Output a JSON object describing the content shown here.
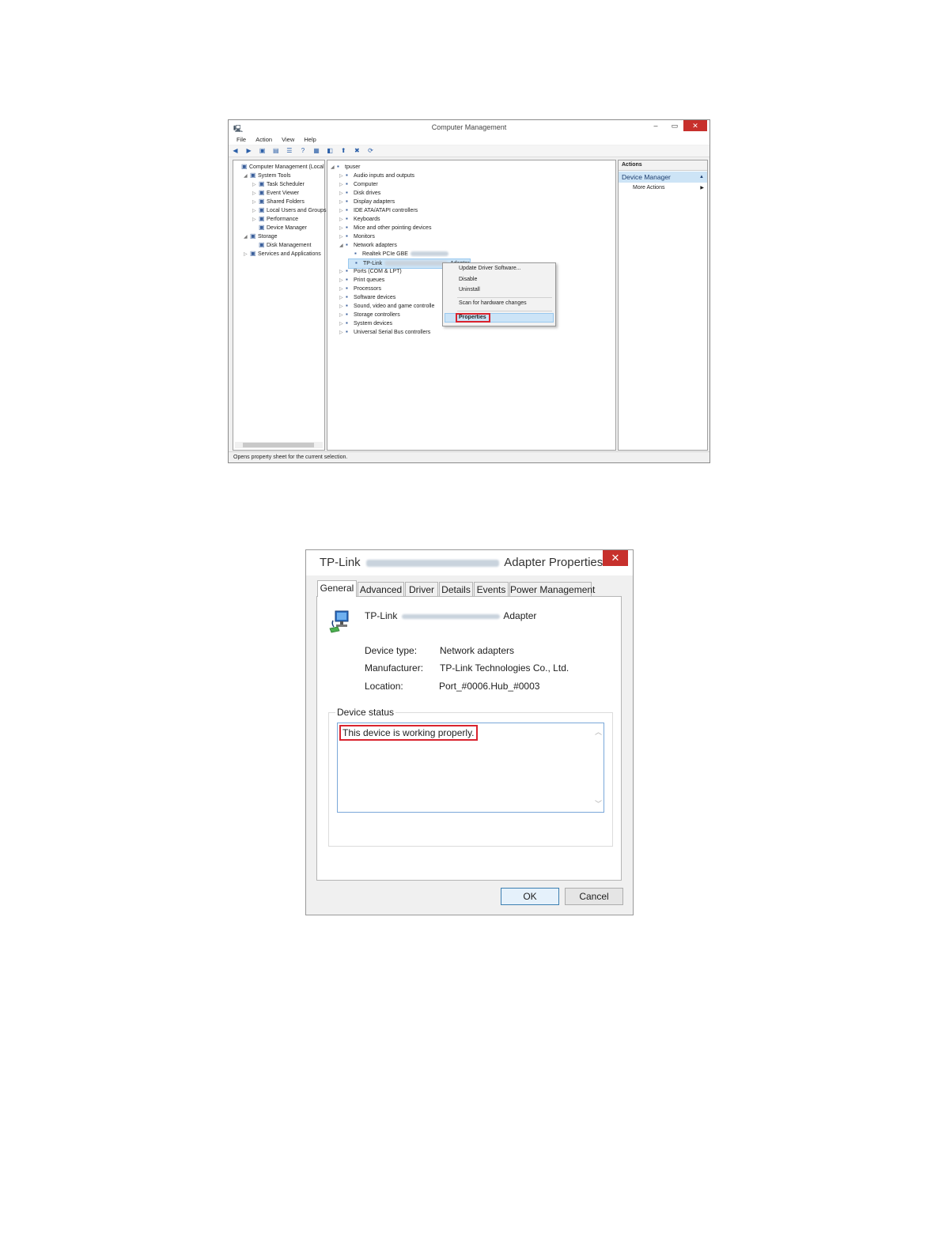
{
  "cm": {
    "title": "Computer Management",
    "menu": [
      "File",
      "Action",
      "View",
      "Help"
    ],
    "tree": [
      {
        "label": "Computer Management (Local",
        "level": 0,
        "twisty": ""
      },
      {
        "label": "System Tools",
        "level": 1,
        "twisty": "◢"
      },
      {
        "label": "Task Scheduler",
        "level": 2,
        "twisty": "▷"
      },
      {
        "label": "Event Viewer",
        "level": 2,
        "twisty": "▷"
      },
      {
        "label": "Shared Folders",
        "level": 2,
        "twisty": "▷"
      },
      {
        "label": "Local Users and Groups",
        "level": 2,
        "twisty": "▷"
      },
      {
        "label": "Performance",
        "level": 2,
        "twisty": "▷"
      },
      {
        "label": "Device Manager",
        "level": 2,
        "twisty": ""
      },
      {
        "label": "Storage",
        "level": 1,
        "twisty": "◢"
      },
      {
        "label": "Disk Management",
        "level": 2,
        "twisty": ""
      },
      {
        "label": "Services and Applications",
        "level": 1,
        "twisty": "▷"
      }
    ],
    "devices": [
      {
        "label": "tpuser",
        "level": 0,
        "twisty": "◢"
      },
      {
        "label": "Audio inputs and outputs",
        "level": 1,
        "twisty": "▷"
      },
      {
        "label": "Computer",
        "level": 1,
        "twisty": "▷"
      },
      {
        "label": "Disk drives",
        "level": 1,
        "twisty": "▷"
      },
      {
        "label": "Display adapters",
        "level": 1,
        "twisty": "▷"
      },
      {
        "label": "IDE ATA/ATAPI controllers",
        "level": 1,
        "twisty": "▷"
      },
      {
        "label": "Keyboards",
        "level": 1,
        "twisty": "▷"
      },
      {
        "label": "Mice and other pointing devices",
        "level": 1,
        "twisty": "▷"
      },
      {
        "label": "Monitors",
        "level": 1,
        "twisty": "▷"
      },
      {
        "label": "Network adapters",
        "level": 1,
        "twisty": "◢"
      },
      {
        "label": "Realtek PCIe GBE",
        "level": 2,
        "twisty": "",
        "blur": true
      },
      {
        "label": "TP-Link",
        "level": 2,
        "twisty": "",
        "blur": true,
        "suffix": "Adapter",
        "selected": true
      },
      {
        "label": "Ports (COM & LPT)",
        "level": 1,
        "twisty": "▷"
      },
      {
        "label": "Print queues",
        "level": 1,
        "twisty": "▷"
      },
      {
        "label": "Processors",
        "level": 1,
        "twisty": "▷"
      },
      {
        "label": "Software devices",
        "level": 1,
        "twisty": "▷"
      },
      {
        "label": "Sound, video and game controlle",
        "level": 1,
        "twisty": "▷"
      },
      {
        "label": "Storage controllers",
        "level": 1,
        "twisty": "▷"
      },
      {
        "label": "System devices",
        "level": 1,
        "twisty": "▷"
      },
      {
        "label": "Universal Serial Bus controllers",
        "level": 1,
        "twisty": "▷"
      }
    ],
    "context_menu": {
      "update": "Update Driver Software...",
      "disable": "Disable",
      "uninstall": "Uninstall",
      "scan": "Scan for hardware changes",
      "properties": "Properties"
    },
    "actions": {
      "header": "Actions",
      "device_manager": "Device Manager",
      "more": "More Actions"
    },
    "status": "Opens property sheet for the current selection."
  },
  "dlg": {
    "title_prefix": "TP-Link",
    "title_suffix": "Adapter Properties",
    "tabs": [
      "General",
      "Advanced",
      "Driver",
      "Details",
      "Events",
      "Power Management"
    ],
    "device_name_prefix": "TP-Link",
    "device_name_suffix": "Adapter",
    "device_type_label": "Device type:",
    "device_type_value": "Network adapters",
    "manufacturer_label": "Manufacturer:",
    "manufacturer_value": "TP-Link Technologies Co., Ltd.",
    "location_label": "Location:",
    "location_value": "Port_#0006.Hub_#0003",
    "status_group": "Device status",
    "status_text": "This device is working properly.",
    "ok": "OK",
    "cancel": "Cancel"
  }
}
